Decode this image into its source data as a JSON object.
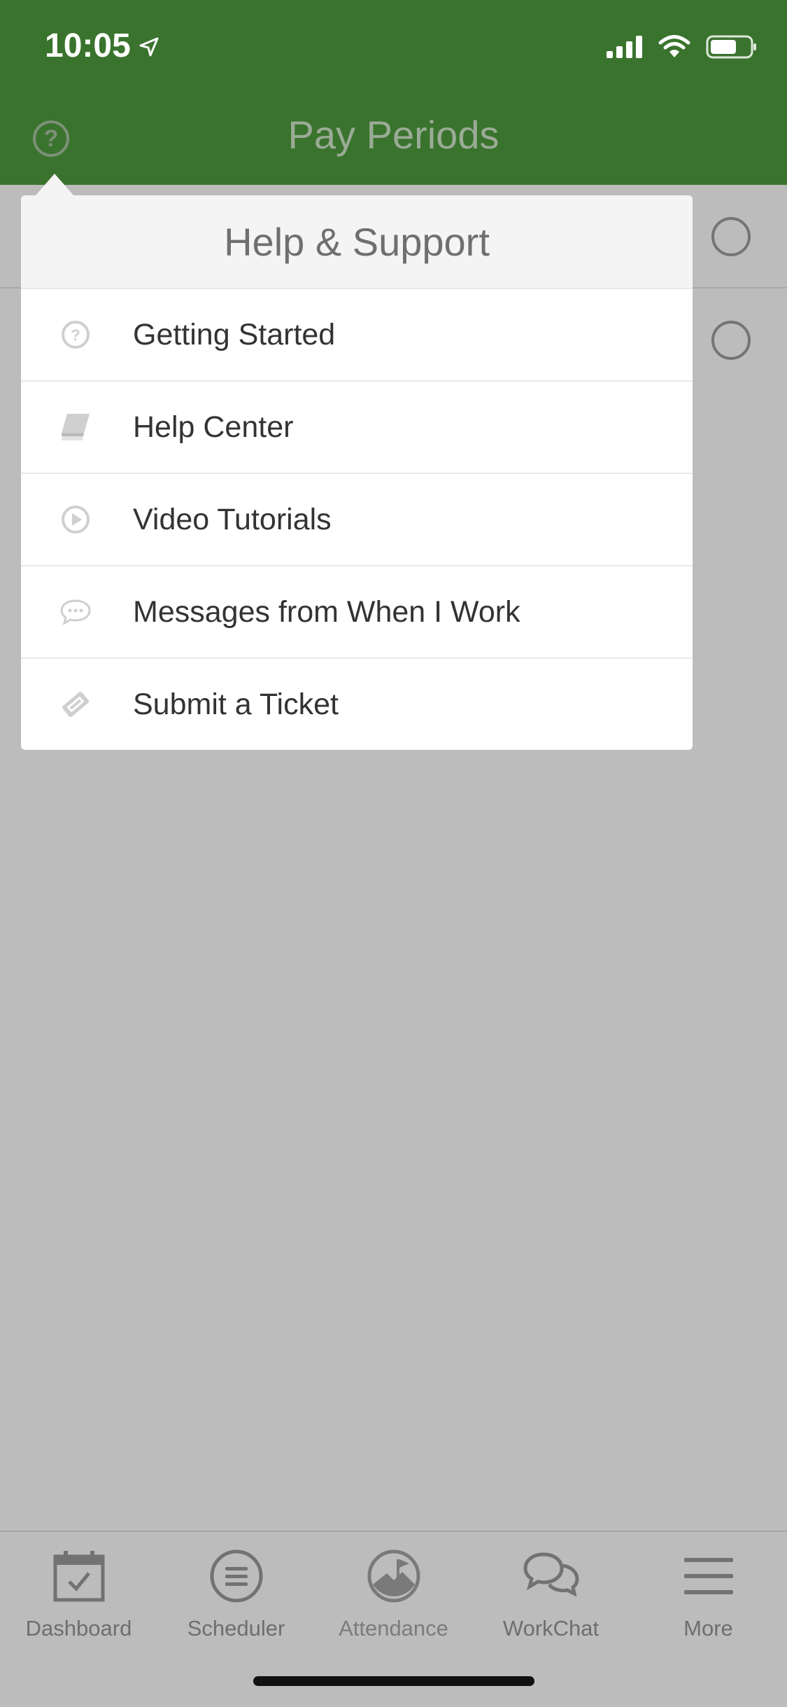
{
  "status_bar": {
    "time": "10:05",
    "icons": [
      "location-arrow-icon",
      "cellular-signal-icon",
      "wifi-icon",
      "battery-icon"
    ]
  },
  "header": {
    "title": "Pay Periods",
    "help_icon": "question-circle-icon",
    "background_color": "#3a732d"
  },
  "popover": {
    "title": "Help & Support",
    "items": [
      {
        "label": "Getting Started",
        "icon": "question-circle-icon"
      },
      {
        "label": "Help Center",
        "icon": "book-icon"
      },
      {
        "label": "Video Tutorials",
        "icon": "play-circle-icon"
      },
      {
        "label": "Messages from When I Work",
        "icon": "chat-bubble-icon"
      },
      {
        "label": "Submit a Ticket",
        "icon": "ticket-icon"
      }
    ]
  },
  "tabbar": {
    "tabs": [
      {
        "label": "Dashboard",
        "icon": "calendar-check-icon"
      },
      {
        "label": "Scheduler",
        "icon": "list-circle-icon"
      },
      {
        "label": "Attendance",
        "icon": "clock-flag-icon"
      },
      {
        "label": "WorkChat",
        "icon": "chat-bubbles-icon"
      },
      {
        "label": "More",
        "icon": "menu-icon"
      }
    ]
  }
}
